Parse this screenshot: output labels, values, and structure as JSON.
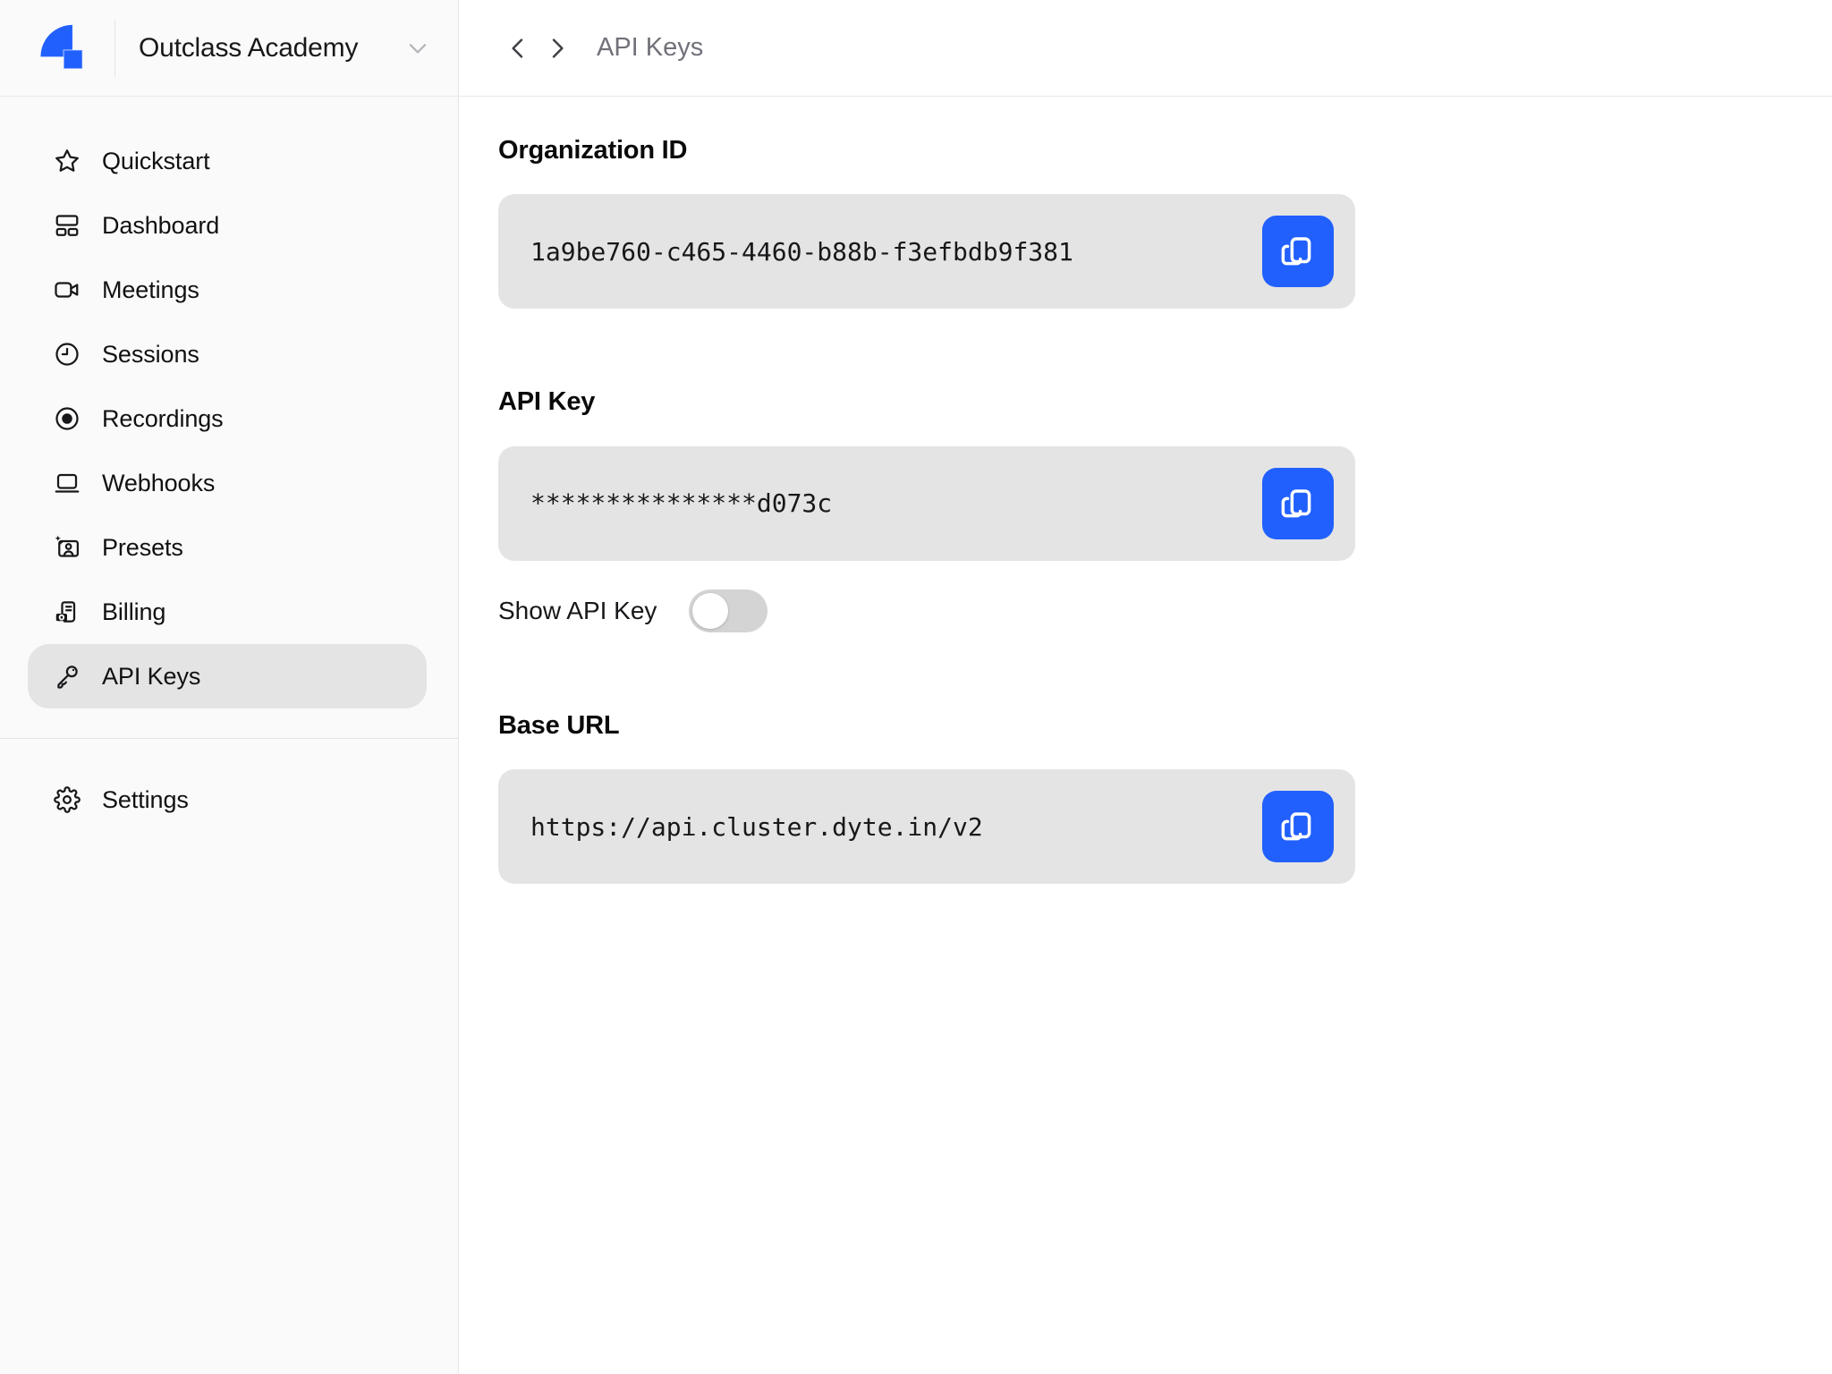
{
  "brand": {
    "org_name": "Outclass Academy",
    "logo_icon": "dyte-logo-icon",
    "dropdown_icon": "chevron-down-icon",
    "logo_color": "#2160fd"
  },
  "topbar": {
    "title": "API Keys",
    "back_icon": "chevron-left-icon",
    "forward_icon": "chevron-right-icon"
  },
  "sidebar": {
    "items": [
      {
        "label": "Quickstart",
        "icon": "star-icon",
        "active": false
      },
      {
        "label": "Dashboard",
        "icon": "dashboard-icon",
        "active": false
      },
      {
        "label": "Meetings",
        "icon": "video-camera-icon",
        "active": false
      },
      {
        "label": "Sessions",
        "icon": "clock-icon",
        "active": false
      },
      {
        "label": "Recordings",
        "icon": "record-icon",
        "active": false
      },
      {
        "label": "Webhooks",
        "icon": "laptop-icon",
        "active": false
      },
      {
        "label": "Presets",
        "icon": "presets-person-icon",
        "active": false
      },
      {
        "label": "Billing",
        "icon": "billing-receipt-icon",
        "active": false
      },
      {
        "label": "API Keys",
        "icon": "key-icon",
        "active": true
      }
    ],
    "footer_items": [
      {
        "label": "Settings",
        "icon": "gear-icon"
      }
    ]
  },
  "content": {
    "sections": [
      {
        "label": "Organization ID",
        "value": "1a9be760-c465-4460-b88b-f3efbdb9f381",
        "action_icon": "copy-icon"
      },
      {
        "label": "API Key",
        "value": "***************d073c",
        "action_icon": "copy-icon"
      },
      {
        "label": "Base URL",
        "value": "https://api.cluster.dyte.in/v2",
        "action_icon": "copy-icon"
      }
    ],
    "show_api_key": {
      "label": "Show API Key",
      "enabled": false
    }
  },
  "colors": {
    "accent": "#2160fd",
    "sidebar_bg": "#fafafa",
    "field_bg": "#e4e4e4",
    "active_item_bg": "#e4e4e4",
    "border": "#e8e8e8",
    "title_gray": "#71717a",
    "toggle_off": "#d4d4d4"
  }
}
